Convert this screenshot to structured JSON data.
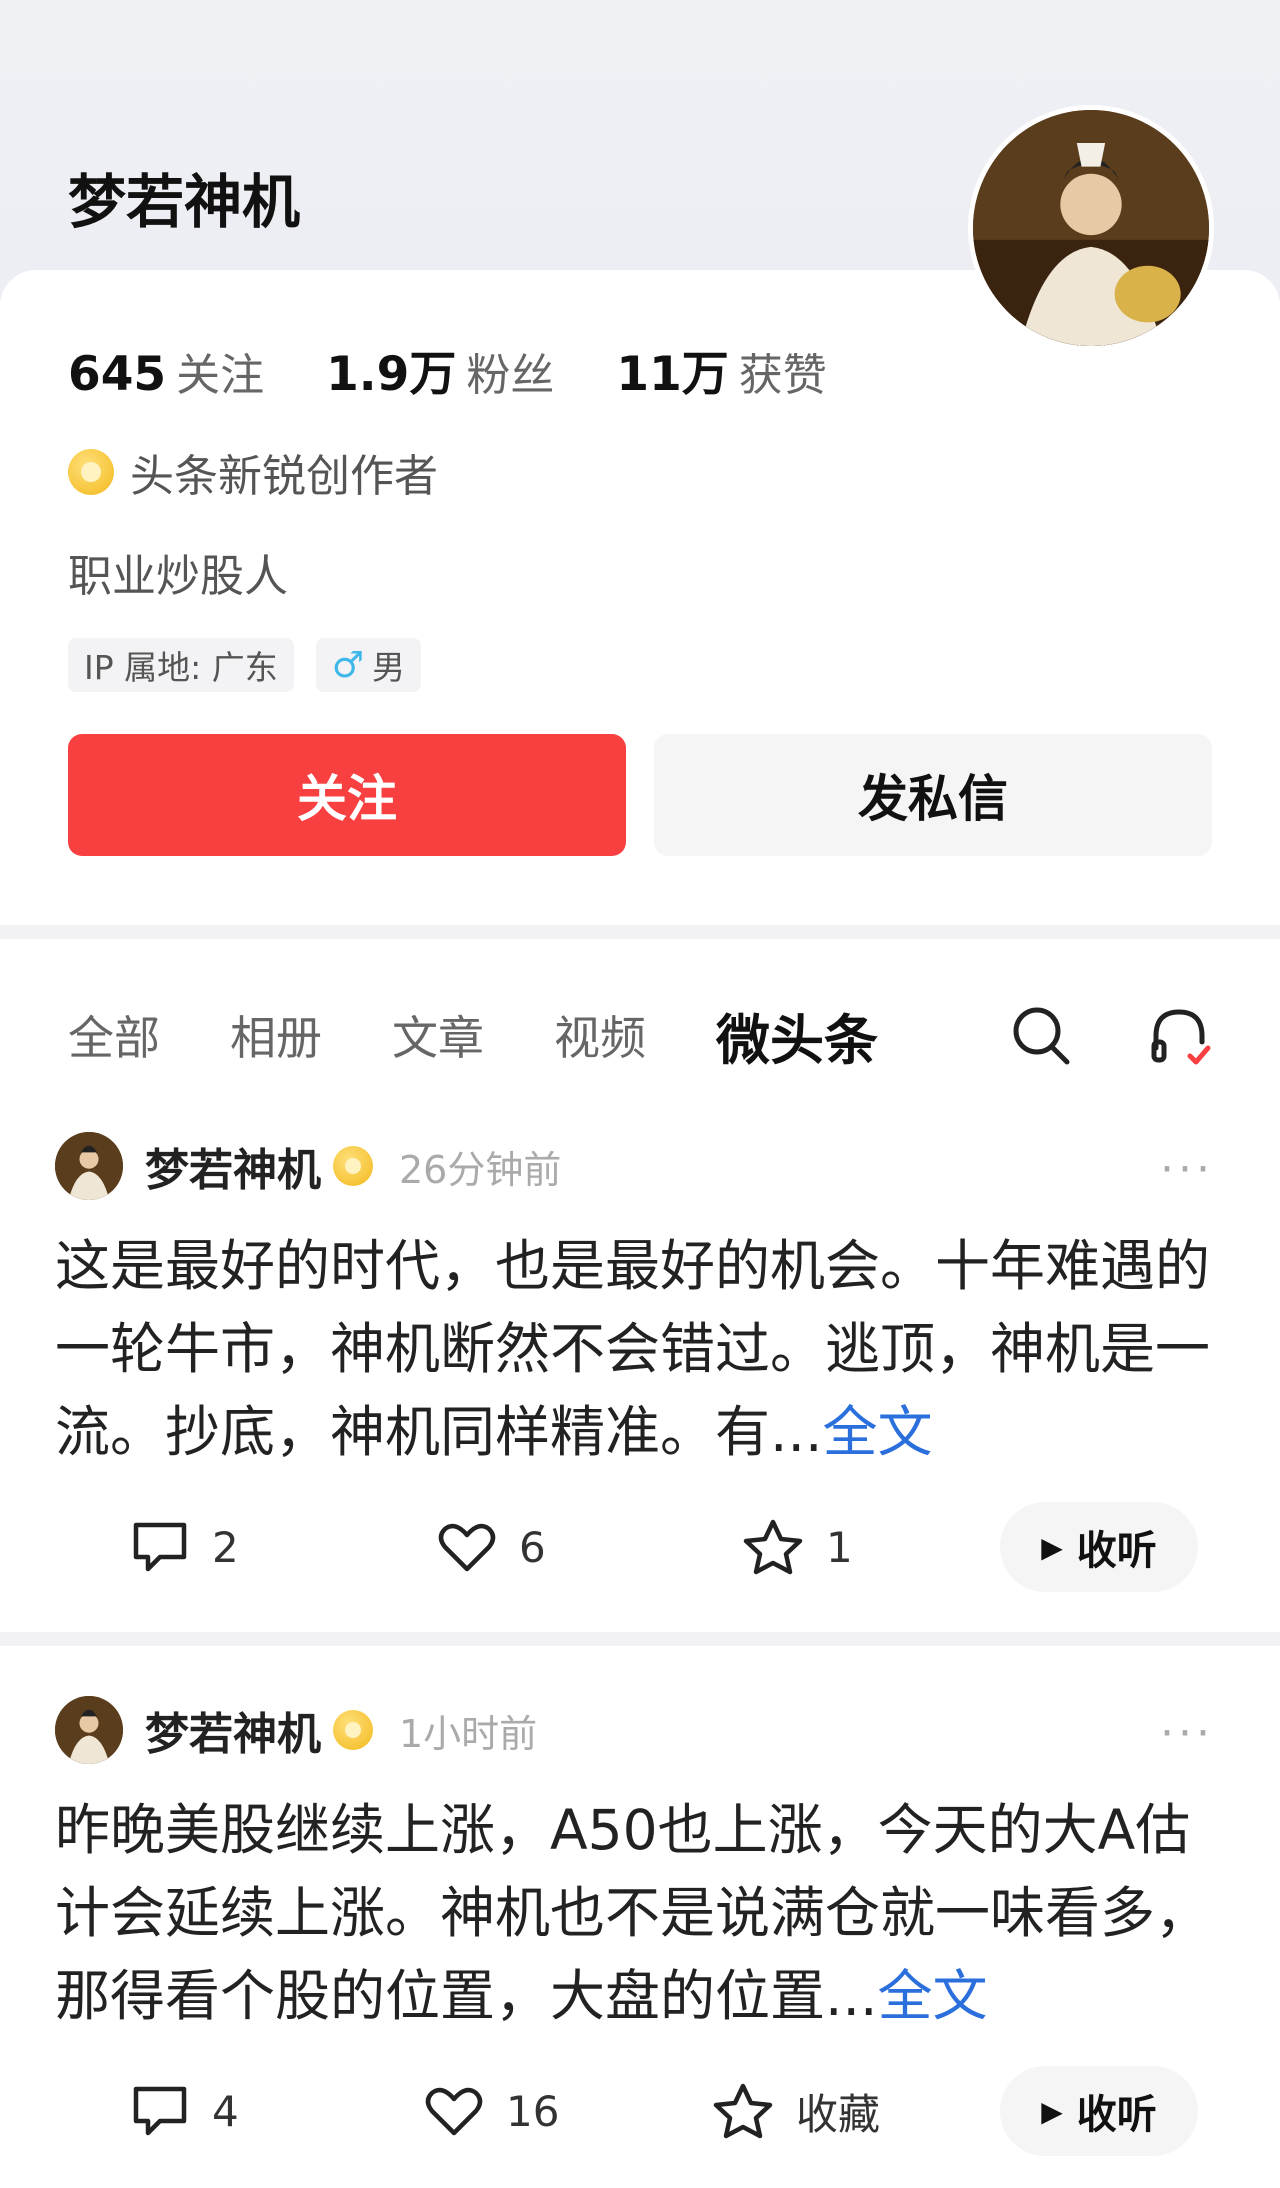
{
  "profile": {
    "name": "梦若神机",
    "stats": [
      {
        "num": "645",
        "label": "关注"
      },
      {
        "num": "1.9万",
        "label": "粉丝"
      },
      {
        "num": "11万",
        "label": "获赞"
      }
    ],
    "creator_label": "头条新锐创作者",
    "bio": "职业炒股人",
    "tags": {
      "ip": "IP 属地: 广东",
      "gender_icon": "♂",
      "gender": "男"
    },
    "follow_label": "关注",
    "message_label": "发私信"
  },
  "tabs": {
    "items": [
      "全部",
      "相册",
      "文章",
      "视频",
      "微头条"
    ],
    "active": "微头条"
  },
  "posts": [
    {
      "author": "梦若神机",
      "time": "26分钟前",
      "more": "···",
      "text": "这是最好的时代，也是最好的机会。十年难遇的一轮牛市，神机断然不会错过。逃顶，神机是一流。抄底，神机同样精准。有...",
      "fulltext": "全文",
      "comments": "2",
      "likes": "6",
      "favorites": "1",
      "listen": "收听"
    },
    {
      "author": "梦若神机",
      "time": "1小时前",
      "more": "···",
      "text": "昨晚美股继续上涨，A50也上涨，今天的大A估计会延续上涨。神机也不是说满仓就一味看多，那得看个股的位置，大盘的位置...",
      "fulltext": "全文",
      "comments": "4",
      "likes": "16",
      "favorites": "收藏",
      "listen": "收听"
    }
  ],
  "colors": {
    "accent": "#f84040",
    "link": "#2a6fdb",
    "badge": "#f2b81c"
  }
}
